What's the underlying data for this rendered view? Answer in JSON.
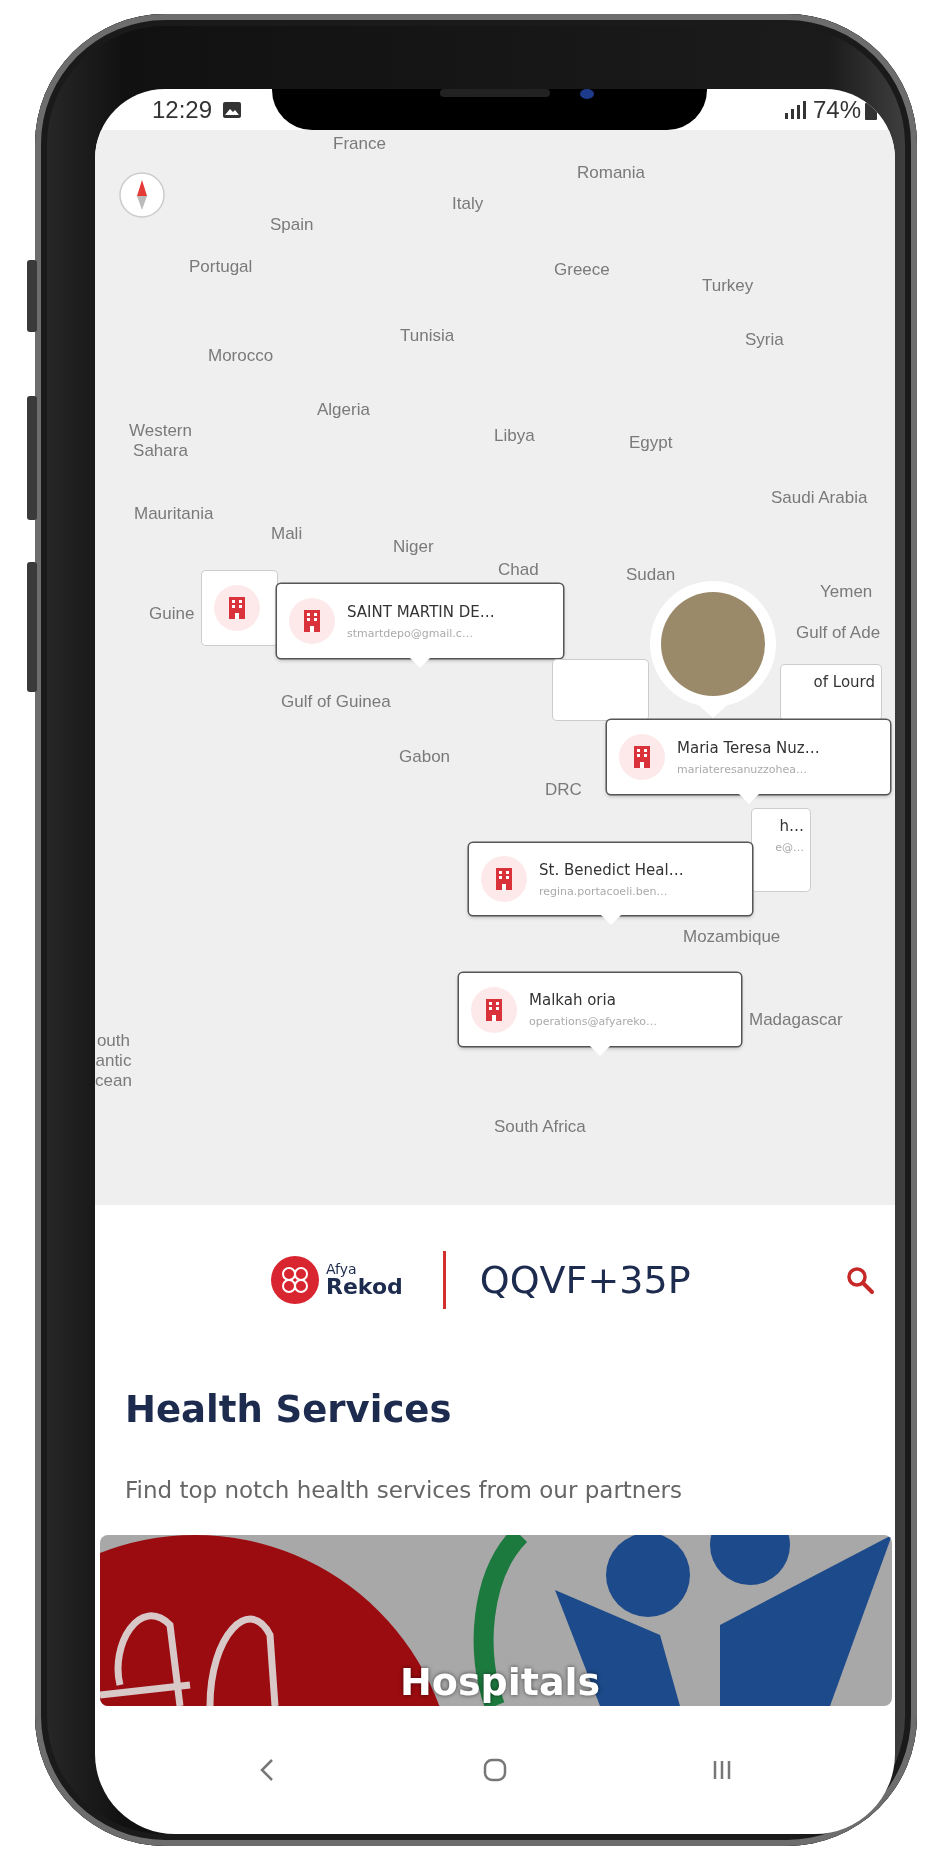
{
  "status_bar": {
    "time": "12:29",
    "battery": "74%"
  },
  "map": {
    "labels": [
      {
        "text": "France"
      },
      {
        "text": "Romania"
      },
      {
        "text": "Italy"
      },
      {
        "text": "Spain"
      },
      {
        "text": "Portugal"
      },
      {
        "text": "Greece"
      },
      {
        "text": "Turkey"
      },
      {
        "text": "Tunisia"
      },
      {
        "text": "Syria"
      },
      {
        "text": "Morocco"
      },
      {
        "text": "Algeria"
      },
      {
        "text": "Western\nSahara"
      },
      {
        "text": "Libya"
      },
      {
        "text": "Egypt"
      },
      {
        "text": "Saudi Arabia"
      },
      {
        "text": "Mauritania"
      },
      {
        "text": "Mali"
      },
      {
        "text": "Niger"
      },
      {
        "text": "Sudan"
      },
      {
        "text": "Chad"
      },
      {
        "text": "Yemen"
      },
      {
        "text": "Gulf of Ade"
      },
      {
        "text": "Guine"
      },
      {
        "text": "Gulf of Guinea"
      },
      {
        "text": "Gabon"
      },
      {
        "text": "DRC"
      },
      {
        "text": "Mozambique"
      },
      {
        "text": "Madagascar"
      },
      {
        "text": "outh\nantic\ncean"
      },
      {
        "text": "South Africa"
      }
    ],
    "markers": [
      {
        "kind": "behind"
      },
      {
        "kind": "pin",
        "title": "SAINT MARTIN DE…",
        "email": "stmartdepo@gmail.c…"
      },
      {
        "kind": "edge"
      },
      {
        "kind": "edge",
        "title": "of Lourd"
      },
      {
        "kind": "pin",
        "title": "Maria Teresa Nuz…",
        "email": "mariateresanuzzohea…"
      },
      {
        "kind": "edge",
        "title": "h…",
        "email": "e@…"
      },
      {
        "kind": "pin",
        "title": "St. Benedict Heal…",
        "email": "regina.portacoeli.ben…"
      },
      {
        "kind": "pin",
        "title": "Malkah oria",
        "email": "operations@afyareko…"
      }
    ]
  },
  "header": {
    "logo_small": "Afya",
    "logo_large": "Rekod",
    "plus_code": "QQVF+35P"
  },
  "section": {
    "title": "Health Services",
    "subtitle": "Find top notch health services from our partners"
  },
  "banner": {
    "label": "Hospitals"
  }
}
